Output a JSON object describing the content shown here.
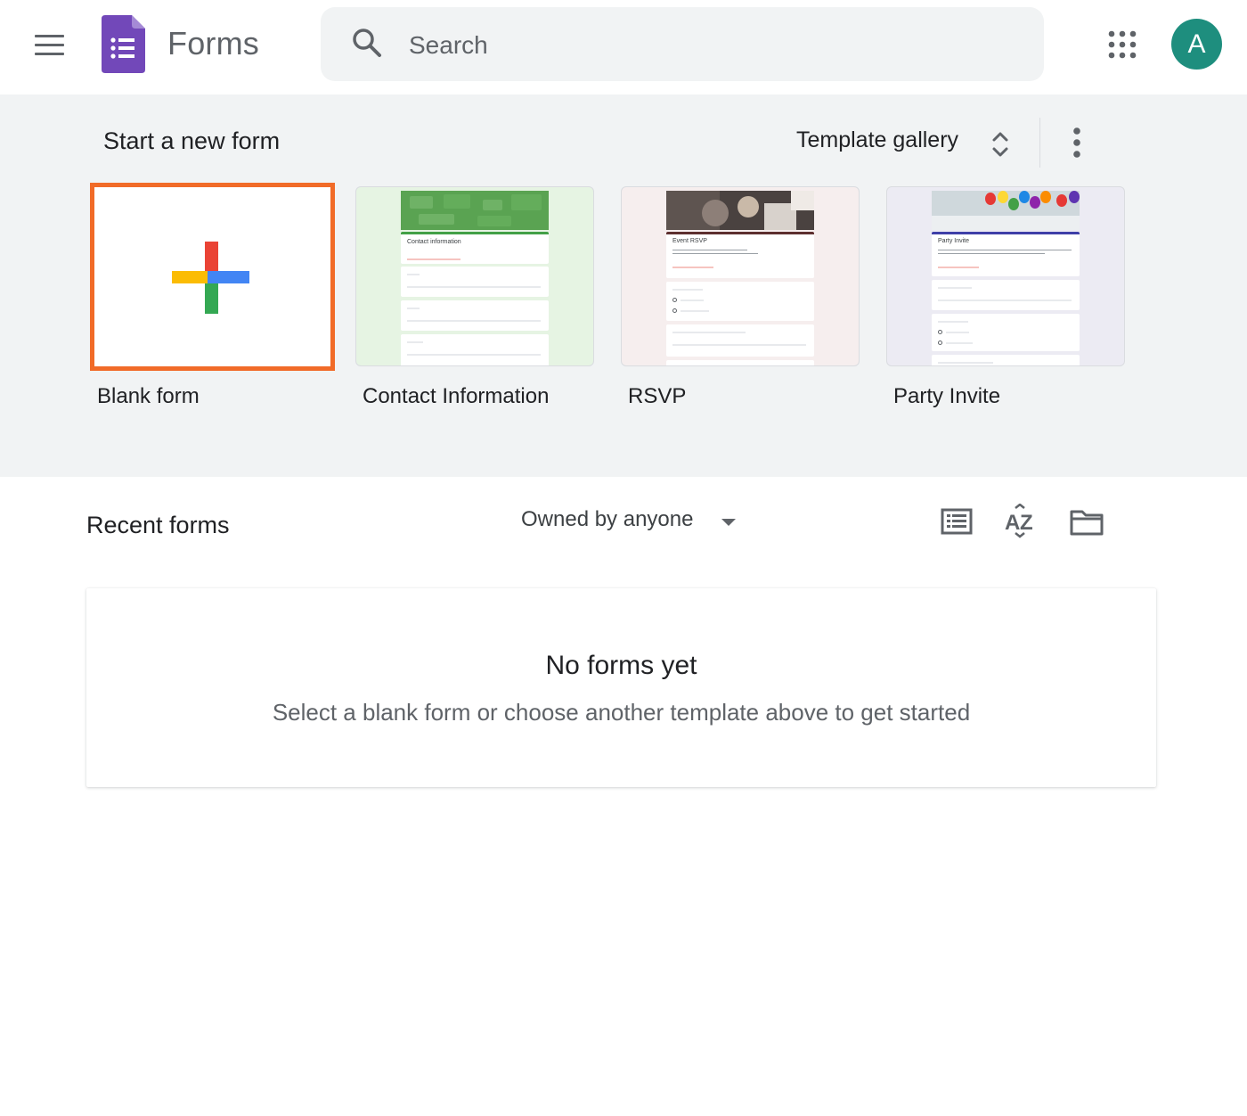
{
  "header": {
    "app_title": "Forms",
    "search_placeholder": "Search",
    "avatar_initial": "A"
  },
  "new_form": {
    "title": "Start a new form",
    "gallery_label": "Template gallery",
    "templates": [
      {
        "label": "Blank form"
      },
      {
        "label": "Contact Information",
        "preview_title": "Contact information",
        "accent": "#43a047"
      },
      {
        "label": "RSVP",
        "preview_title": "Event RSVP",
        "accent": "#5d2f2f"
      },
      {
        "label": "Party Invite",
        "preview_title": "Party Invite",
        "accent": "#3f3fa8"
      }
    ]
  },
  "recent": {
    "title": "Recent forms",
    "owner_filter": "Owned by anyone",
    "empty_title": "No forms yet",
    "empty_subtitle": "Select a blank form or choose another template above to get started"
  },
  "colors": {
    "brand": "#7248b9",
    "selected_border": "#f16b28",
    "avatar_bg": "#1e8e7e"
  }
}
